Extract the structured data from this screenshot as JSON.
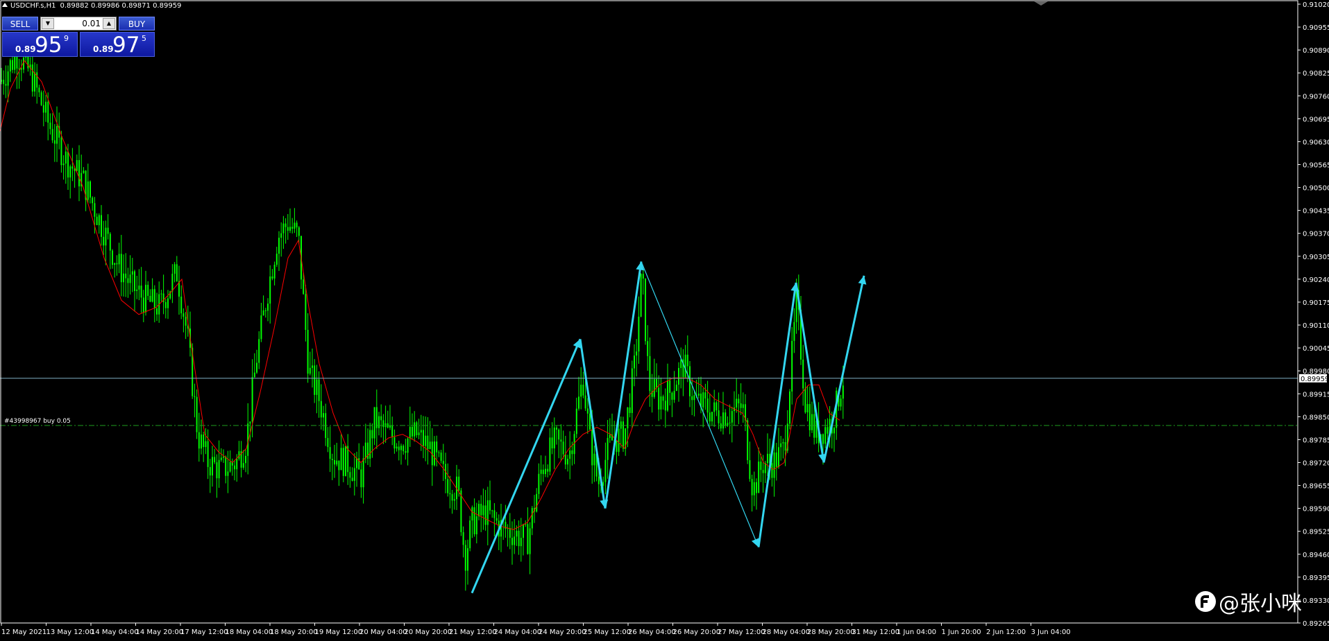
{
  "header": {
    "symbol": "USDCHF.s,H1",
    "ohlc": "0.89882 0.89986 0.89871 0.89959"
  },
  "trade_panel": {
    "sell_label": "SELL",
    "buy_label": "BUY",
    "lot": "0.01",
    "sell_price_prefix": "0.89",
    "sell_price_big": "95",
    "sell_price_sup": "9",
    "buy_price_prefix": "0.89",
    "buy_price_big": "97",
    "buy_price_sup": "5"
  },
  "order_label": "#43998967 buy 0.05",
  "current_price_label": "0.89959",
  "watermark": "@张小咪",
  "colors": {
    "background": "#000000",
    "candle": "#00ff00",
    "ma_line": "#ff0000",
    "zigzag": "#33d6f0",
    "bid_line": "#7fb2c6",
    "order_line": "#1e9e1e",
    "axis": "#ffffff"
  },
  "chart_data": {
    "type": "candlestick",
    "symbol": "USDCHF.s",
    "timeframe": "H1",
    "ylim": [
      0.89265,
      0.9102
    ],
    "y_ticks": [
      "0.91020",
      "0.90955",
      "0.90890",
      "0.90825",
      "0.90760",
      "0.90695",
      "0.90630",
      "0.90565",
      "0.90500",
      "0.90435",
      "0.90370",
      "0.90305",
      "0.90240",
      "0.90175",
      "0.90110",
      "0.90045",
      "0.89980",
      "0.89915",
      "0.89850",
      "0.89785",
      "0.89720",
      "0.89655",
      "0.89590",
      "0.89525",
      "0.89460",
      "0.89395",
      "0.89330",
      "0.89265"
    ],
    "x_ticks": [
      "12 May 2021",
      "13 May 12:00",
      "14 May 04:00",
      "14 May 20:00",
      "17 May 12:00",
      "18 May 04:00",
      "18 May 20:00",
      "19 May 12:00",
      "20 May 04:00",
      "20 May 20:00",
      "21 May 12:00",
      "24 May 04:00",
      "24 May 20:00",
      "25 May 12:00",
      "26 May 04:00",
      "26 May 20:00",
      "27 May 12:00",
      "28 May 04:00",
      "28 May 20:00",
      "31 May 12:00",
      "1 Jun 04:00",
      "1 Jun 20:00",
      "2 Jun 12:00",
      "3 Jun 04:00"
    ],
    "close_path": [
      [
        0,
        0.908
      ],
      [
        25,
        0.9088
      ],
      [
        45,
        0.9082
      ],
      [
        70,
        0.9068
      ],
      [
        95,
        0.9058
      ],
      [
        120,
        0.9052
      ],
      [
        145,
        0.904
      ],
      [
        170,
        0.9028
      ],
      [
        190,
        0.9022
      ],
      [
        210,
        0.9018
      ],
      [
        230,
        0.9016
      ],
      [
        255,
        0.9026
      ],
      [
        270,
        0.9008
      ],
      [
        285,
        0.898
      ],
      [
        300,
        0.8972
      ],
      [
        320,
        0.897
      ],
      [
        340,
        0.8972
      ],
      [
        355,
        0.8978
      ],
      [
        370,
        0.9002
      ],
      [
        385,
        0.902
      ],
      [
        400,
        0.9036
      ],
      [
        415,
        0.904
      ],
      [
        430,
        0.9036
      ],
      [
        445,
        0.8998
      ],
      [
        460,
        0.899
      ],
      [
        480,
        0.8974
      ],
      [
        500,
        0.8972
      ],
      [
        520,
        0.8968
      ],
      [
        540,
        0.8984
      ],
      [
        560,
        0.898
      ],
      [
        580,
        0.8978
      ],
      [
        600,
        0.898
      ],
      [
        620,
        0.8976
      ],
      [
        640,
        0.8968
      ],
      [
        660,
        0.8964
      ],
      [
        670,
        0.8945
      ],
      [
        680,
        0.8955
      ],
      [
        700,
        0.8958
      ],
      [
        720,
        0.8954
      ],
      [
        740,
        0.8952
      ],
      [
        760,
        0.895
      ],
      [
        780,
        0.897
      ],
      [
        800,
        0.8978
      ],
      [
        820,
        0.8974
      ],
      [
        840,
        0.8996
      ],
      [
        850,
        0.8978
      ],
      [
        862,
        0.8966
      ],
      [
        880,
        0.8978
      ],
      [
        900,
        0.898
      ],
      [
        915,
        0.9
      ],
      [
        925,
        0.9026
      ],
      [
        935,
        0.8994
      ],
      [
        950,
        0.899
      ],
      [
        965,
        0.8992
      ],
      [
        985,
        0.9
      ],
      [
        1000,
        0.899
      ],
      [
        1015,
        0.8988
      ],
      [
        1030,
        0.8986
      ],
      [
        1050,
        0.8986
      ],
      [
        1070,
        0.8988
      ],
      [
        1085,
        0.8964
      ],
      [
        1100,
        0.8972
      ],
      [
        1115,
        0.8972
      ],
      [
        1130,
        0.8976
      ],
      [
        1148,
        0.9018
      ],
      [
        1160,
        0.899
      ],
      [
        1175,
        0.898
      ],
      [
        1190,
        0.8982
      ],
      [
        1200,
        0.8984
      ],
      [
        1215,
        0.8996
      ]
    ],
    "moving_average": [
      [
        0,
        0.9066
      ],
      [
        15,
        0.9078
      ],
      [
        35,
        0.9086
      ],
      [
        60,
        0.908
      ],
      [
        90,
        0.9064
      ],
      [
        120,
        0.905
      ],
      [
        150,
        0.903
      ],
      [
        175,
        0.9018
      ],
      [
        200,
        0.9014
      ],
      [
        225,
        0.9016
      ],
      [
        245,
        0.902
      ],
      [
        262,
        0.9024
      ],
      [
        275,
        0.9006
      ],
      [
        295,
        0.898
      ],
      [
        315,
        0.8975
      ],
      [
        335,
        0.8972
      ],
      [
        355,
        0.8976
      ],
      [
        375,
        0.8992
      ],
      [
        395,
        0.901
      ],
      [
        415,
        0.903
      ],
      [
        430,
        0.9035
      ],
      [
        445,
        0.9016
      ],
      [
        460,
        0.9
      ],
      [
        480,
        0.8986
      ],
      [
        500,
        0.8976
      ],
      [
        520,
        0.8972
      ],
      [
        540,
        0.8976
      ],
      [
        560,
        0.8979
      ],
      [
        580,
        0.898
      ],
      [
        600,
        0.8978
      ],
      [
        620,
        0.8975
      ],
      [
        640,
        0.897
      ],
      [
        660,
        0.8964
      ],
      [
        680,
        0.8958
      ],
      [
        700,
        0.8956
      ],
      [
        720,
        0.8954
      ],
      [
        740,
        0.8953
      ],
      [
        760,
        0.8955
      ],
      [
        780,
        0.8962
      ],
      [
        800,
        0.897
      ],
      [
        820,
        0.8976
      ],
      [
        840,
        0.898
      ],
      [
        860,
        0.8982
      ],
      [
        880,
        0.898
      ],
      [
        900,
        0.8976
      ],
      [
        915,
        0.8984
      ],
      [
        930,
        0.899
      ],
      [
        950,
        0.8994
      ],
      [
        970,
        0.8996
      ],
      [
        990,
        0.8996
      ],
      [
        1010,
        0.8994
      ],
      [
        1030,
        0.899
      ],
      [
        1050,
        0.8988
      ],
      [
        1070,
        0.8986
      ],
      [
        1085,
        0.898
      ],
      [
        1100,
        0.8972
      ],
      [
        1115,
        0.897
      ],
      [
        1130,
        0.8972
      ],
      [
        1148,
        0.899
      ],
      [
        1165,
        0.8994
      ],
      [
        1180,
        0.8994
      ],
      [
        1195,
        0.8986
      ],
      [
        1210,
        0.8984
      ]
    ],
    "zigzag": [
      [
        680,
        0.8935
      ],
      [
        836,
        0.9007
      ],
      [
        872,
        0.8959
      ],
      [
        924,
        0.9029
      ],
      [
        1093,
        0.8948
      ],
      [
        1147,
        0.9023
      ],
      [
        1187,
        0.8972
      ],
      [
        1245,
        0.9025
      ]
    ],
    "bid_price": 0.89959,
    "order_price": 0.89825
  }
}
